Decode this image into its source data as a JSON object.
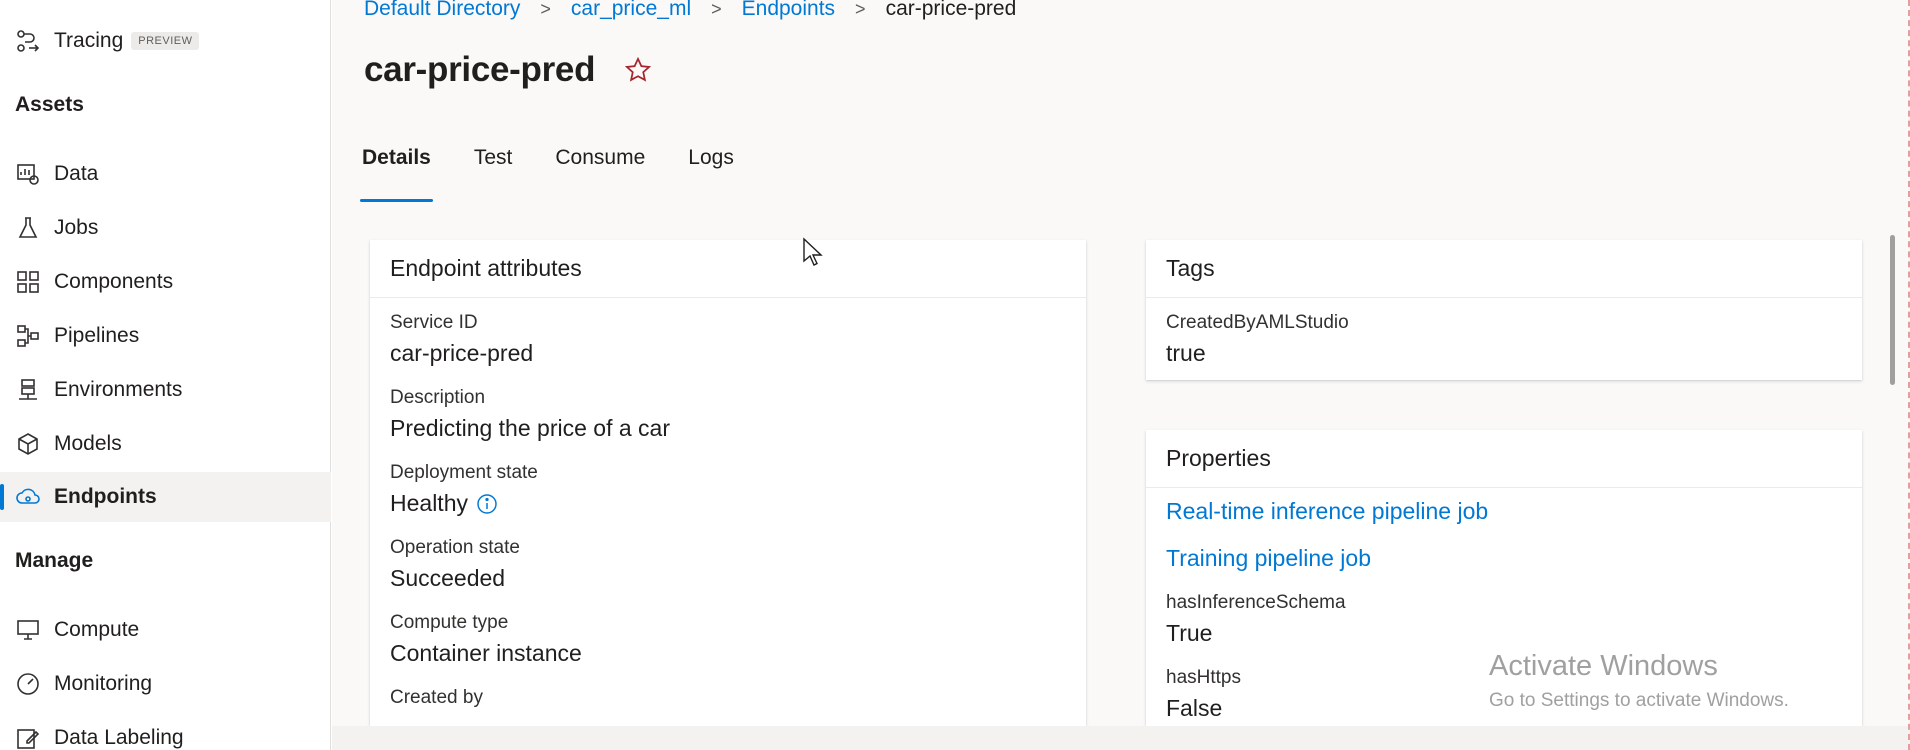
{
  "sidebar": {
    "tracing_label": "Tracing",
    "tracing_badge": "PREVIEW",
    "assets_title": "Assets",
    "manage_title": "Manage",
    "assets": [
      {
        "label": "Data",
        "icon": "data-icon"
      },
      {
        "label": "Jobs",
        "icon": "flask-icon"
      },
      {
        "label": "Components",
        "icon": "components-icon"
      },
      {
        "label": "Pipelines",
        "icon": "pipelines-icon"
      },
      {
        "label": "Environments",
        "icon": "environments-icon"
      },
      {
        "label": "Models",
        "icon": "cube-icon"
      },
      {
        "label": "Endpoints",
        "icon": "cloud-endpoint-icon",
        "active": true
      }
    ],
    "manage": [
      {
        "label": "Compute",
        "icon": "monitor-icon"
      },
      {
        "label": "Monitoring",
        "icon": "gauge-icon"
      },
      {
        "label": "Data Labeling",
        "icon": "edit-icon"
      }
    ]
  },
  "breadcrumb": {
    "items": [
      "Default Directory",
      "car_price_ml",
      "Endpoints"
    ],
    "current": "car-price-pred"
  },
  "page": {
    "title": "car-price-pred",
    "tabs": [
      "Details",
      "Test",
      "Consume",
      "Logs"
    ],
    "active_tab": "Details"
  },
  "endpoint_attributes": {
    "title": "Endpoint attributes",
    "fields": [
      {
        "label": "Service ID",
        "value": "car-price-pred"
      },
      {
        "label": "Description",
        "value": "Predicting the price of a car"
      },
      {
        "label": "Deployment state",
        "value": "Healthy"
      },
      {
        "label": "Operation state",
        "value": "Succeeded"
      },
      {
        "label": "Compute type",
        "value": "Container instance"
      },
      {
        "label": "Created by",
        "value": ""
      }
    ]
  },
  "tags": {
    "title": "Tags",
    "label": "CreatedByAMLStudio",
    "value": "true"
  },
  "properties": {
    "title": "Properties",
    "links": [
      "Real-time inference pipeline job",
      "Training pipeline job"
    ],
    "fields": [
      {
        "label": "hasInferenceSchema",
        "value": "True"
      },
      {
        "label": "hasHttps",
        "value": "False"
      }
    ]
  },
  "watermark": {
    "title": "Activate Windows",
    "subtitle": "Go to Settings to activate Windows."
  },
  "colors": {
    "accent": "#0078d4",
    "star": "#a4262c"
  }
}
